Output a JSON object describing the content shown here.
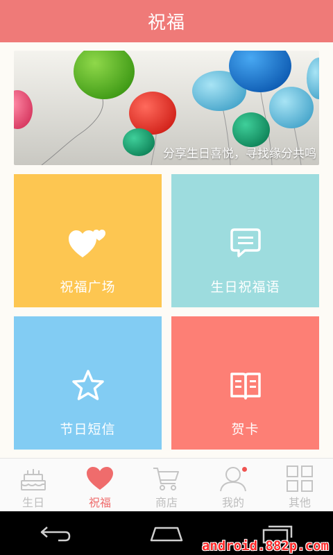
{
  "header": {
    "title": "祝福"
  },
  "banner": {
    "caption": "分享生日喜悦，寻找缘分共鸣"
  },
  "tiles": [
    {
      "label": "祝福广场",
      "icon": "hearts-icon",
      "color": "#fdc651"
    },
    {
      "label": "生日祝福语",
      "icon": "chat-icon",
      "color": "#9ddcde"
    },
    {
      "label": "节日短信",
      "icon": "star-icon",
      "color": "#82ccf3"
    },
    {
      "label": "贺卡",
      "icon": "book-icon",
      "color": "#fd7f75"
    }
  ],
  "tabbar": {
    "items": [
      {
        "label": "生日",
        "icon": "cake-icon",
        "active": false
      },
      {
        "label": "祝福",
        "icon": "heart-icon",
        "active": true
      },
      {
        "label": "商店",
        "icon": "cart-icon",
        "active": false
      },
      {
        "label": "我的",
        "icon": "person-icon",
        "active": false,
        "badge_dot": true
      },
      {
        "label": "其他",
        "icon": "grid-icon",
        "active": false
      }
    ]
  },
  "watermark": "android.882p.com",
  "colors": {
    "accent": "#ef7a78",
    "active_tab": "#ef6c6c",
    "inactive_tab": "#bdbdbd"
  }
}
